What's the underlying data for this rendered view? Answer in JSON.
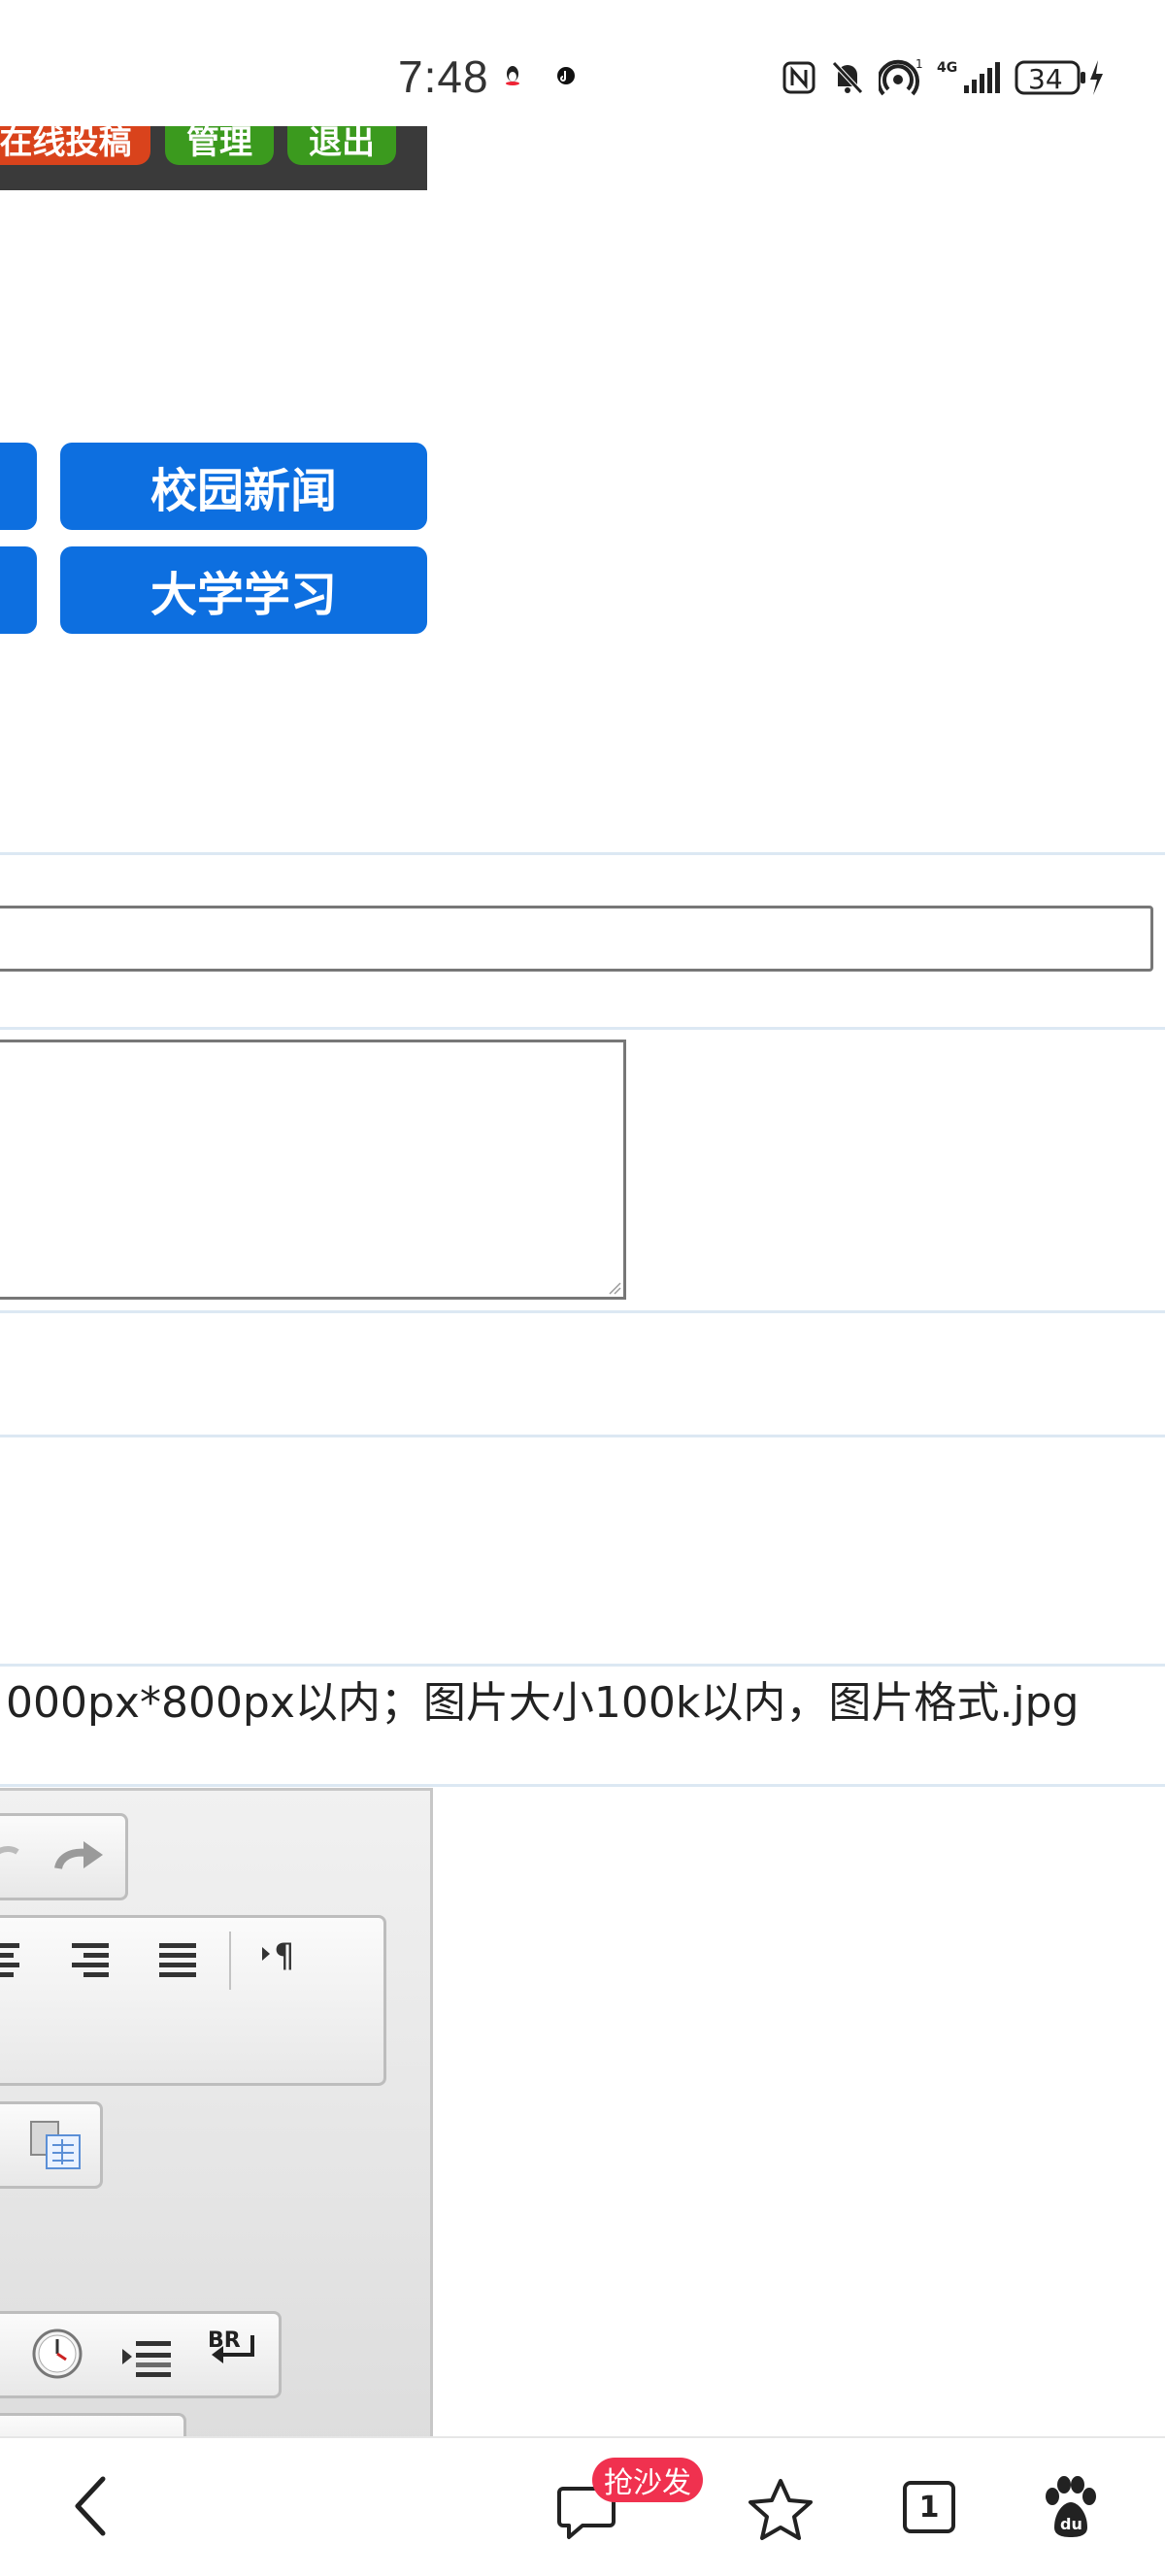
{
  "status_bar": {
    "time": "7:48",
    "signal_label": "4G",
    "battery": "34"
  },
  "nav": {
    "buttons": [
      {
        "label": "在线投稿",
        "color": "#d9431c"
      },
      {
        "label": "管理",
        "color": "#3b9a1e"
      },
      {
        "label": "退出",
        "color": "#3b9a1e"
      }
    ]
  },
  "categories": [
    {
      "label": "校园新闻"
    },
    {
      "label": "大学学习"
    }
  ],
  "form": {
    "title_value": "",
    "summary_value": "",
    "image_hint": "000px*800px以内；图片大小100k以内，图片格式.jpg"
  },
  "editor": {
    "toolbar_icons": [
      "undo-icon",
      "redo-icon",
      "align-center-icon",
      "align-right-icon",
      "justify-icon",
      "paragraph-mark-icon",
      "paste-from-word-icon",
      "clock-icon",
      "indent-icon",
      "line-break-icon"
    ]
  },
  "browser_bar": {
    "comment_badge": "抢沙发",
    "tab_count": "1"
  }
}
